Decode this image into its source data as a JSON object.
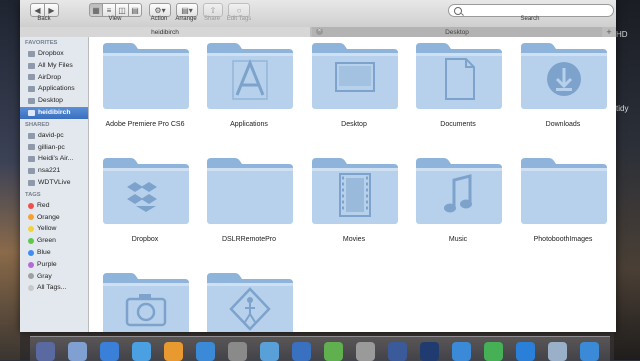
{
  "toolbar": {
    "back_label": "Back",
    "view_label": "View",
    "action_label": "Action",
    "arrange_label": "Arrange",
    "share_label": "Share",
    "edit_tags_label": "Edit Tags",
    "search_label": "Search",
    "search_placeholder": ""
  },
  "tabs": [
    {
      "label": "heidibirch"
    },
    {
      "label": "Desktop"
    }
  ],
  "sidebar": {
    "favorites_header": "FAVORITES",
    "favorites": [
      {
        "label": "Dropbox",
        "icon": "dropbox-icon"
      },
      {
        "label": "All My Files",
        "icon": "all-files-icon"
      },
      {
        "label": "AirDrop",
        "icon": "airdrop-icon"
      },
      {
        "label": "Applications",
        "icon": "applications-icon"
      },
      {
        "label": "Desktop",
        "icon": "desktop-icon"
      },
      {
        "label": "heidibirch",
        "icon": "home-icon",
        "selected": true
      }
    ],
    "shared_header": "SHARED",
    "shared": [
      {
        "label": "david-pc"
      },
      {
        "label": "gillian-pc"
      },
      {
        "label": "Heidi's Air..."
      },
      {
        "label": "nsa221"
      },
      {
        "label": "WDTVLive"
      }
    ],
    "tags_header": "TAGS",
    "tags": [
      {
        "label": "Red",
        "color": "#f0504a"
      },
      {
        "label": "Orange",
        "color": "#f5a030"
      },
      {
        "label": "Yellow",
        "color": "#f2d33a"
      },
      {
        "label": "Green",
        "color": "#5ec84a"
      },
      {
        "label": "Blue",
        "color": "#3d8ef0"
      },
      {
        "label": "Purple",
        "color": "#b36ad6"
      },
      {
        "label": "Gray",
        "color": "#a0a0a0"
      },
      {
        "label": "All Tags...",
        "color": "#c8c8c8"
      }
    ]
  },
  "folders": [
    {
      "name": "Adobe Premiere Pro CS6",
      "glyph": "plain"
    },
    {
      "name": "Applications",
      "glyph": "apps"
    },
    {
      "name": "Desktop",
      "glyph": "desktop"
    },
    {
      "name": "Documents",
      "glyph": "doc"
    },
    {
      "name": "Downloads",
      "glyph": "download"
    },
    {
      "name": "Dropbox",
      "glyph": "dropbox"
    },
    {
      "name": "DSLRRemotePro",
      "glyph": "plain"
    },
    {
      "name": "Movies",
      "glyph": "film"
    },
    {
      "name": "Music",
      "glyph": "music"
    },
    {
      "name": "PhotoboothImages",
      "glyph": "plain"
    },
    {
      "name": "",
      "glyph": "camera"
    },
    {
      "name": "",
      "glyph": "public"
    }
  ],
  "desktop": {
    "right_text_1": "HD",
    "right_text_2": "tidy"
  },
  "colors": {
    "folder_light": "#b7d1ec",
    "folder_dark": "#8fb4dc",
    "glyph": "#7da3cc",
    "selection": "#3a6fc0"
  }
}
